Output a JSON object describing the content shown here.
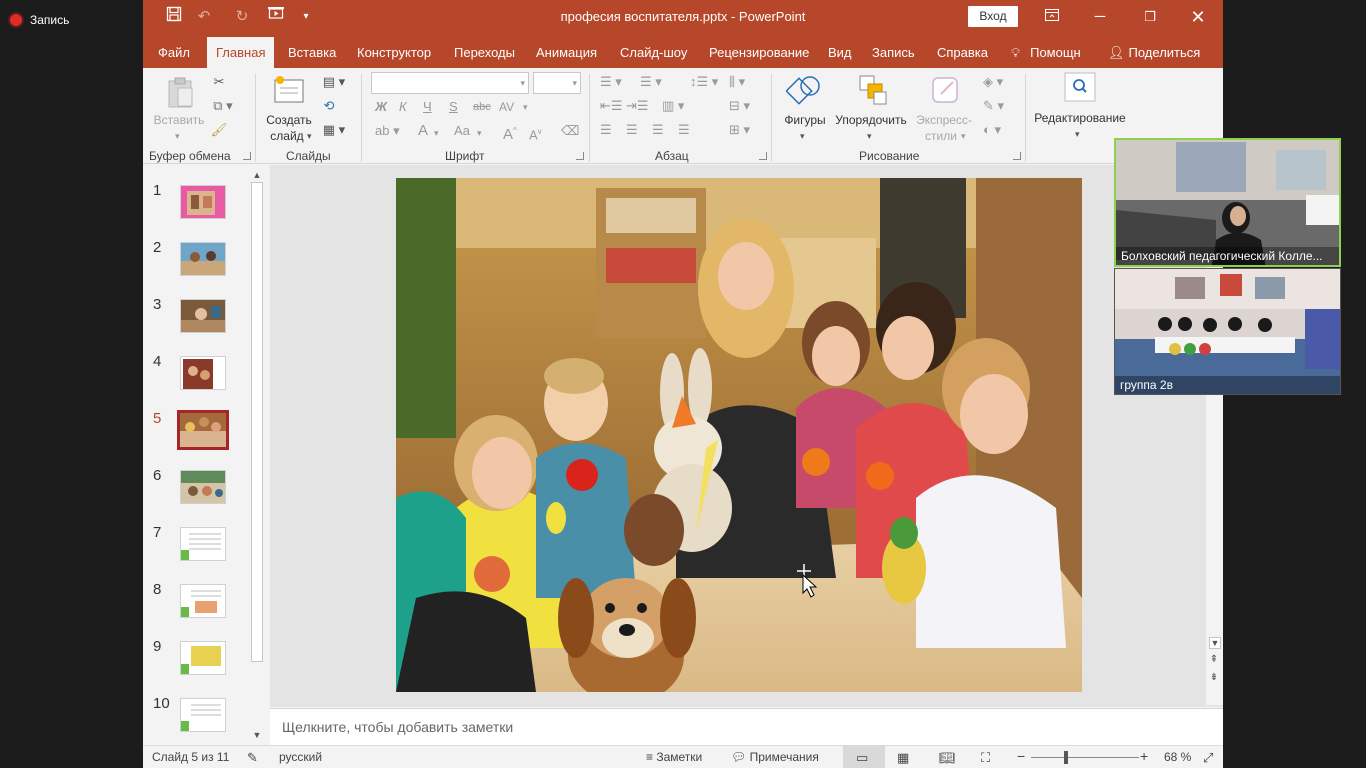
{
  "recording": {
    "label": "Запись"
  },
  "window": {
    "title": "професия воспитателя.pptx  -  PowerPoint",
    "login_label": "Вход",
    "qa_icons": [
      "save-icon",
      "undo-icon",
      "redo-icon",
      "start-from-beginning-icon",
      "customize-qat-icon"
    ],
    "accent_color": "#b7472a"
  },
  "menu": {
    "tabs": [
      "Файл",
      "Главная",
      "Вставка",
      "Конструктор",
      "Переходы",
      "Анимация",
      "Слайд-шоу",
      "Рецензирование",
      "Вид",
      "Запись",
      "Справка"
    ],
    "active_tab": "Главная",
    "help_label": "Помощн",
    "share_label": "Поделиться"
  },
  "ribbon": {
    "groups": {
      "clipboard": "Буфер обмена",
      "slides": "Слайды",
      "font": "Шрифт",
      "paragraph": "Абзац",
      "drawing": "Рисование"
    },
    "paste_label": "Вставить",
    "new_slide_label_1": "Создать",
    "new_slide_label_2": "слайд",
    "font_buttons": {
      "bold": "Ж",
      "italic": "К",
      "underline": "Ч",
      "shadow": "S",
      "strike": "abc",
      "spacing": "AV",
      "font_color": "A",
      "change_case": "Aa"
    },
    "shapes_label": "Фигуры",
    "arrange_label": "Упорядочить",
    "quick_styles_label_1": "Экспресс-",
    "quick_styles_label_2": "стили",
    "editing_label": "Редактирование"
  },
  "slides": {
    "numbers": [
      "1",
      "2",
      "3",
      "4",
      "5",
      "6",
      "7",
      "8",
      "9",
      "10"
    ],
    "active_index": 5
  },
  "notes": {
    "placeholder": "Щелкните, чтобы добавить заметки"
  },
  "status": {
    "slide_info": "Слайд 5 из 11",
    "language": "русский",
    "notes_label": "Заметки",
    "comments_label": "Примечания",
    "zoom_level": "68 %",
    "zoom_slider_value": 0.5
  },
  "participants": [
    {
      "name": "Болховский педагогический Колле..."
    },
    {
      "name": "группа 2в"
    }
  ]
}
